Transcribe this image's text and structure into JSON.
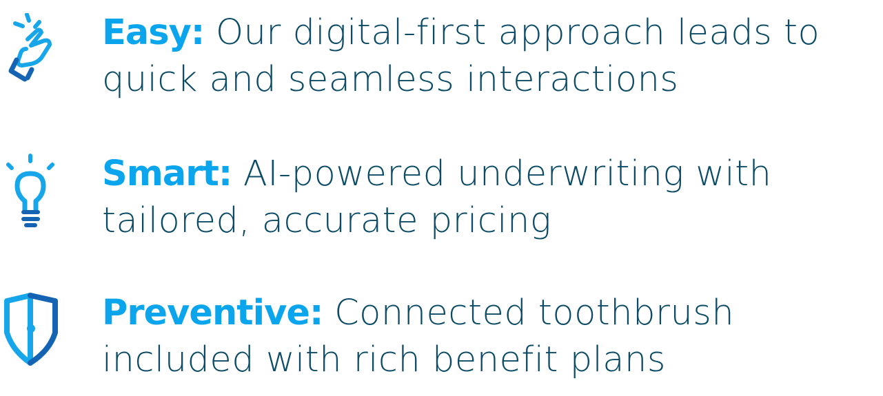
{
  "colors": {
    "accent": "#0aa5ec",
    "body_text": "#0c4b66",
    "icon_light": "#18a6ea",
    "icon_dark": "#1464b3"
  },
  "features": [
    {
      "icon": "hand-tap-icon",
      "title": "Easy:",
      "line1": " Our digital-first approach leads to",
      "line2": "quick and seamless interactions"
    },
    {
      "icon": "lightbulb-icon",
      "title": "Smart:",
      "line1": " AI-powered underwriting with",
      "line2": "tailored, accurate pricing"
    },
    {
      "icon": "shield-icon",
      "title": "Preventive:",
      "line1": " Connected toothbrush",
      "line2": "included with rich benefit plans"
    }
  ]
}
